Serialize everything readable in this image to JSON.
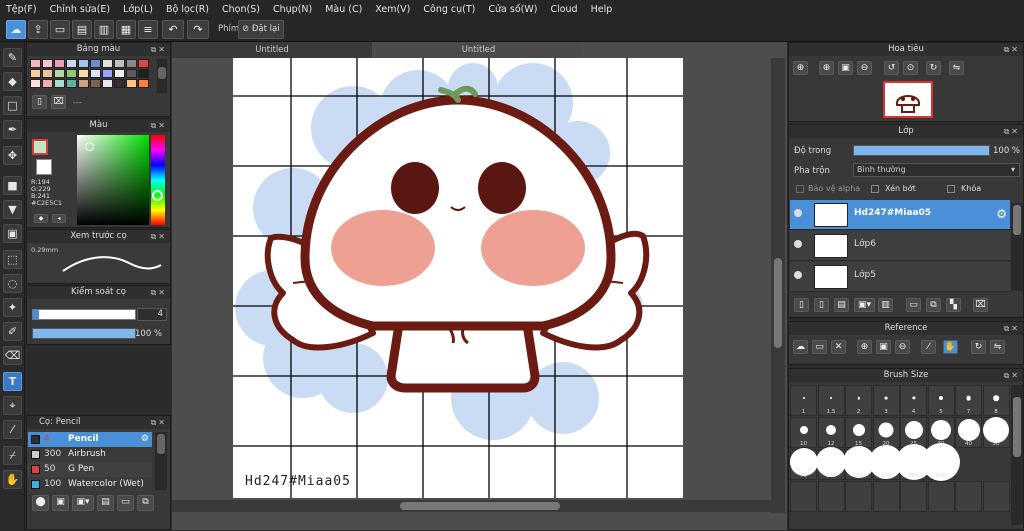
{
  "menu": [
    "Tệp(F)",
    "Chỉnh sửa(E)",
    "Lớp(L)",
    "Bộ lọc(R)",
    "Chọn(S)",
    "Chụp(N)",
    "Màu (C)",
    "Xem(V)",
    "Công cụ(T)",
    "Cửa số(W)",
    "Cloud",
    "Help"
  ],
  "toolbar": {
    "phim_label": "Phím",
    "reset_label": "Đặt lại"
  },
  "tabs": {
    "left": "Untitled",
    "right": "Untitled"
  },
  "palette": {
    "title": "Bảng màu",
    "label": "---",
    "swatches": [
      "#f4b6c2",
      "#f7c5d0",
      "#e8a0b4",
      "#c9d8f0",
      "#aac4e8",
      "#6a8fd0",
      "#e0e0e0",
      "#c0c0c0",
      "#8a8a8a",
      "#d44",
      "#f8d0a0",
      "#f0c0a0",
      "#b0d8a0",
      "#90c878",
      "#f4e0a0",
      "#e0e0ff",
      "#a0a0ff",
      "#f0f0f0",
      "#5a5a5a",
      "#202020",
      "#ffe0e0",
      "#f0b0b0",
      "#a0e0d0",
      "#60b0a0",
      "#d0a080",
      "#806050",
      "#e8e8e8",
      "#303030",
      "#ffc080",
      "#ff8040"
    ]
  },
  "color": {
    "title": "Màu",
    "r": "R:194",
    "g": "G:229",
    "b": "B:241",
    "hex": "#C2E5C1"
  },
  "preview": {
    "title": "Xem trước cọ",
    "size": "0.29mm"
  },
  "brush_control": {
    "title": "Kiểm soát cọ",
    "size_value": "4",
    "opacity_value": "100 %",
    "opacity_fill": 1.0
  },
  "brushes": {
    "title": "Cọ: Pencil",
    "items": [
      {
        "size": "4",
        "name": "Pencil",
        "swatch": "#2e2e2e",
        "selected": true
      },
      {
        "size": "300",
        "name": "Airbrush",
        "swatch": "#cccccc",
        "selected": false
      },
      {
        "size": "50",
        "name": "G Pen",
        "swatch": "#e04040",
        "selected": false
      },
      {
        "size": "100",
        "name": "Watercolor (Wet)",
        "swatch": "#40b0e0",
        "selected": false
      }
    ]
  },
  "navigator": {
    "title": "Hoa tiêu"
  },
  "layers": {
    "title": "Lớp",
    "opacity_label": "Độ trong",
    "opacity_value": "100 %",
    "opacity_fill": 1.0,
    "blend_label": "Pha trộn",
    "blend_value": "Bình thường",
    "protect_alpha": "Bảo vệ alpha",
    "clipping": "Xén bớt",
    "lock": "Khóa",
    "items": [
      {
        "name": "Hd247#Miaa05",
        "selected": true
      },
      {
        "name": "Lớp6",
        "selected": false
      },
      {
        "name": "Lớp5",
        "selected": false
      }
    ]
  },
  "reference": {
    "title": "Reference"
  },
  "brush_size": {
    "title": "Brush Size",
    "sizes": [
      "1",
      "1.5",
      "2",
      "3",
      "4",
      "5",
      "7",
      "8",
      "10",
      "12",
      "15",
      "20",
      "25",
      "30",
      "40",
      "50",
      "70",
      "100",
      "150",
      "200",
      "300",
      "400"
    ],
    "dots": [
      1,
      1,
      1.2,
      1.4,
      1.6,
      2,
      2.4,
      2.8,
      4,
      5,
      6,
      7.5,
      9,
      10,
      11,
      13,
      14,
      15,
      16,
      17,
      18,
      19
    ]
  },
  "canvas_text": "Hd247#Miaa05"
}
